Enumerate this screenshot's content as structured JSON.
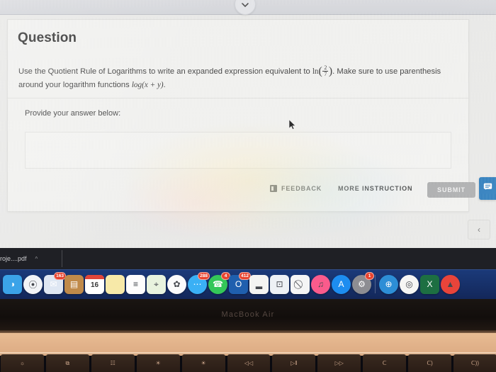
{
  "browser": {
    "scroll_button_icon": "chevron-down-icon"
  },
  "question_card": {
    "title": "Question",
    "prompt_part1": "Use the Quotient Rule of Logarithms to write an expanded expression equivalent to",
    "math_ln": "ln",
    "math_fraction_numerator": "2",
    "math_fraction_denominator": "7",
    "prompt_part2": ". Make sure to use parenthesis around your logarithm functions",
    "math_log": "log(x + y)",
    "prompt_part3": ".",
    "provide_answer_label": "Provide your answer below:",
    "answer_value": "",
    "answer_placeholder": ""
  },
  "actions": {
    "feedback_label": "FEEDBACK",
    "feedback_icon": "flag-icon",
    "more_instruction_label": "MORE INSTRUCTION",
    "submit_label": "SUBMIT",
    "submit_disabled_color": "#a8a9aa"
  },
  "side_widgets": {
    "chat_icon": "chat-bubble-icon",
    "chat_color": "#1a72b8",
    "back_label": "‹",
    "back_icon": "chevron-left-icon"
  },
  "download_bar": {
    "file_name": "roje....pdf",
    "caret_icon": "chevron-up-icon"
  },
  "dock": {
    "background_color": "#17316a",
    "items": [
      {
        "name": "finder",
        "icon": "finder-icon",
        "badge": "",
        "color": "#3ba3e8",
        "glyph": "◑"
      },
      {
        "name": "safari",
        "icon": "safari-icon",
        "badge": "",
        "color": "#f2f4f7",
        "glyph": "⦿"
      },
      {
        "name": "mail",
        "icon": "mail-icon",
        "badge": "163",
        "color": "#dfe7f3",
        "glyph": "✉"
      },
      {
        "name": "contacts",
        "icon": "contacts-icon",
        "badge": "",
        "color": "#c08a4a",
        "glyph": "▤"
      },
      {
        "name": "calendar",
        "icon": "calendar-icon",
        "badge": "",
        "color": "#ffffff",
        "glyph": "16"
      },
      {
        "name": "notes",
        "icon": "notes-icon",
        "badge": "",
        "color": "#f7e9a8",
        "glyph": ""
      },
      {
        "name": "reminders",
        "icon": "reminders-icon",
        "badge": "",
        "color": "#fdfdfd",
        "glyph": "≡"
      },
      {
        "name": "maps",
        "icon": "maps-icon",
        "badge": "",
        "color": "#e8f3de",
        "glyph": "⌖"
      },
      {
        "name": "photos",
        "icon": "photos-icon",
        "badge": "",
        "color": "#fbfbfb",
        "glyph": "✿"
      },
      {
        "name": "messages",
        "icon": "messages-icon",
        "badge": "288",
        "color": "#3ab0f5",
        "glyph": "⋯"
      },
      {
        "name": "facetime",
        "icon": "facetime-icon",
        "badge": "4",
        "color": "#34c759",
        "glyph": "☎"
      },
      {
        "name": "outlook",
        "icon": "outlook-icon",
        "badge": "412",
        "color": "#1f5fae",
        "glyph": "O"
      },
      {
        "name": "numbers",
        "icon": "numbers-icon",
        "badge": "",
        "color": "#f4f4f2",
        "glyph": "▂"
      },
      {
        "name": "keynote",
        "icon": "keynote-icon",
        "badge": "",
        "color": "#eef1f5",
        "glyph": "⊡"
      },
      {
        "name": "adblock",
        "icon": "no-entry-icon",
        "badge": "",
        "color": "#f5f5f5",
        "glyph": "⃠"
      },
      {
        "name": "itunes",
        "icon": "music-note-icon",
        "badge": "",
        "color": "#fa5b8c",
        "glyph": "♫"
      },
      {
        "name": "app-store",
        "icon": "app-store-icon",
        "badge": "",
        "color": "#1d8df0",
        "glyph": "A"
      },
      {
        "name": "system-preferences",
        "icon": "gear-icon",
        "badge": "1",
        "color": "#8d8d92",
        "glyph": "⚙"
      },
      {
        "name": "separator",
        "icon": "divider",
        "badge": "",
        "color": "",
        "glyph": ""
      },
      {
        "name": "google-earth",
        "icon": "globe-icon",
        "badge": "",
        "color": "#2d8ed6",
        "glyph": "⊕"
      },
      {
        "name": "chrome",
        "icon": "chrome-icon",
        "badge": "",
        "color": "#f6f6f4",
        "glyph": "◎"
      },
      {
        "name": "excel",
        "icon": "excel-icon",
        "badge": "",
        "color": "#1d6f42",
        "glyph": "X"
      },
      {
        "name": "vlc",
        "icon": "vlc-cone-icon",
        "badge": "",
        "color": "#e8443a",
        "glyph": "▲"
      }
    ]
  },
  "laptop": {
    "model_name": "MacBook Air",
    "function_keys": [
      {
        "name": "brightness-down",
        "icon": "sun-small-icon",
        "glyph": "☼"
      },
      {
        "name": "mission-control",
        "icon": "mission-control-icon",
        "glyph": "⧉"
      },
      {
        "name": "launchpad",
        "icon": "launchpad-icon",
        "glyph": "☷"
      },
      {
        "name": "keyboard-brightness-down",
        "icon": "keyboard-dim-icon",
        "glyph": "☀"
      },
      {
        "name": "keyboard-brightness-up",
        "icon": "keyboard-bright-icon",
        "glyph": "☀"
      },
      {
        "name": "rewind",
        "icon": "rewind-icon",
        "glyph": "◁◁"
      },
      {
        "name": "play-pause",
        "icon": "play-pause-icon",
        "glyph": "▷‖"
      },
      {
        "name": "fast-forward",
        "icon": "fast-forward-icon",
        "glyph": "▷▷"
      },
      {
        "name": "mute",
        "icon": "mute-icon",
        "glyph": "ᑕ"
      },
      {
        "name": "volume-down",
        "icon": "volume-down-icon",
        "glyph": "ᑕ)"
      },
      {
        "name": "volume-up",
        "icon": "volume-up-icon",
        "glyph": "ᑕ))"
      }
    ]
  }
}
